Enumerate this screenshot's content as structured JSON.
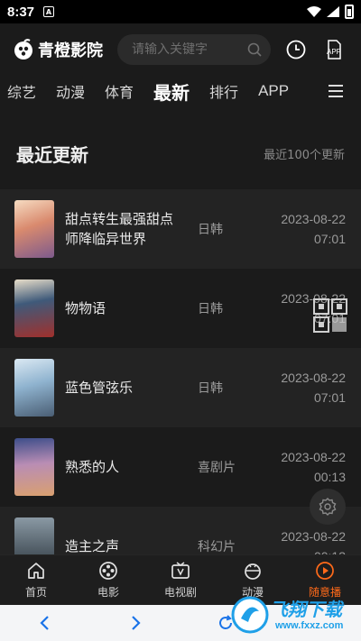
{
  "status_bar": {
    "time": "8:37",
    "notification_glyph": "A"
  },
  "header": {
    "app_name": "青橙影院",
    "search_placeholder": "请输入关键字",
    "icons": [
      "history-icon",
      "app-download-icon"
    ],
    "app_icon_label": "APP"
  },
  "tabs": [
    {
      "label": "综艺",
      "active": false
    },
    {
      "label": "动漫",
      "active": false
    },
    {
      "label": "体育",
      "active": false
    },
    {
      "label": "最新",
      "active": true
    },
    {
      "label": "排行",
      "active": false
    },
    {
      "label": "APP",
      "active": false
    }
  ],
  "section": {
    "title": "最近更新",
    "subtitle": "最近100个更新"
  },
  "items": [
    {
      "title": "甜点转生最强甜点师降临异世界",
      "genre": "日韩",
      "date": "2023-08-22",
      "time": "07:01",
      "poster_color": "#e8c3a8"
    },
    {
      "title": "物物语",
      "genre": "日韩",
      "date": "2023-08-22",
      "time": "07:01",
      "poster_color": "#7a3b3b"
    },
    {
      "title": "蓝色管弦乐",
      "genre": "日韩",
      "date": "2023-08-22",
      "time": "07:01",
      "poster_color": "#9ec3dc"
    },
    {
      "title": "熟悉的人",
      "genre": "喜剧片",
      "date": "2023-08-22",
      "time": "00:13",
      "poster_color": "#8b7fa8"
    },
    {
      "title": "造主之声",
      "genre": "科幻片",
      "date": "2023-08-22",
      "time": "00:13",
      "poster_color": "#6f7c86"
    }
  ],
  "bottom_nav": [
    {
      "label": "首页",
      "icon": "home-icon",
      "active": false
    },
    {
      "label": "电影",
      "icon": "film-reel-icon",
      "active": false
    },
    {
      "label": "电视剧",
      "icon": "tv-icon",
      "active": false
    },
    {
      "label": "动漫",
      "icon": "anime-icon",
      "active": false
    },
    {
      "label": "随意播",
      "icon": "play-circle-icon",
      "active": true
    }
  ],
  "watermark": {
    "text": "飞翔下载",
    "url": "www.fxxz.com"
  },
  "colors": {
    "accent": "#ff6a1a",
    "background": "#1b1b1b",
    "browser_icon": "#1a73e8"
  }
}
